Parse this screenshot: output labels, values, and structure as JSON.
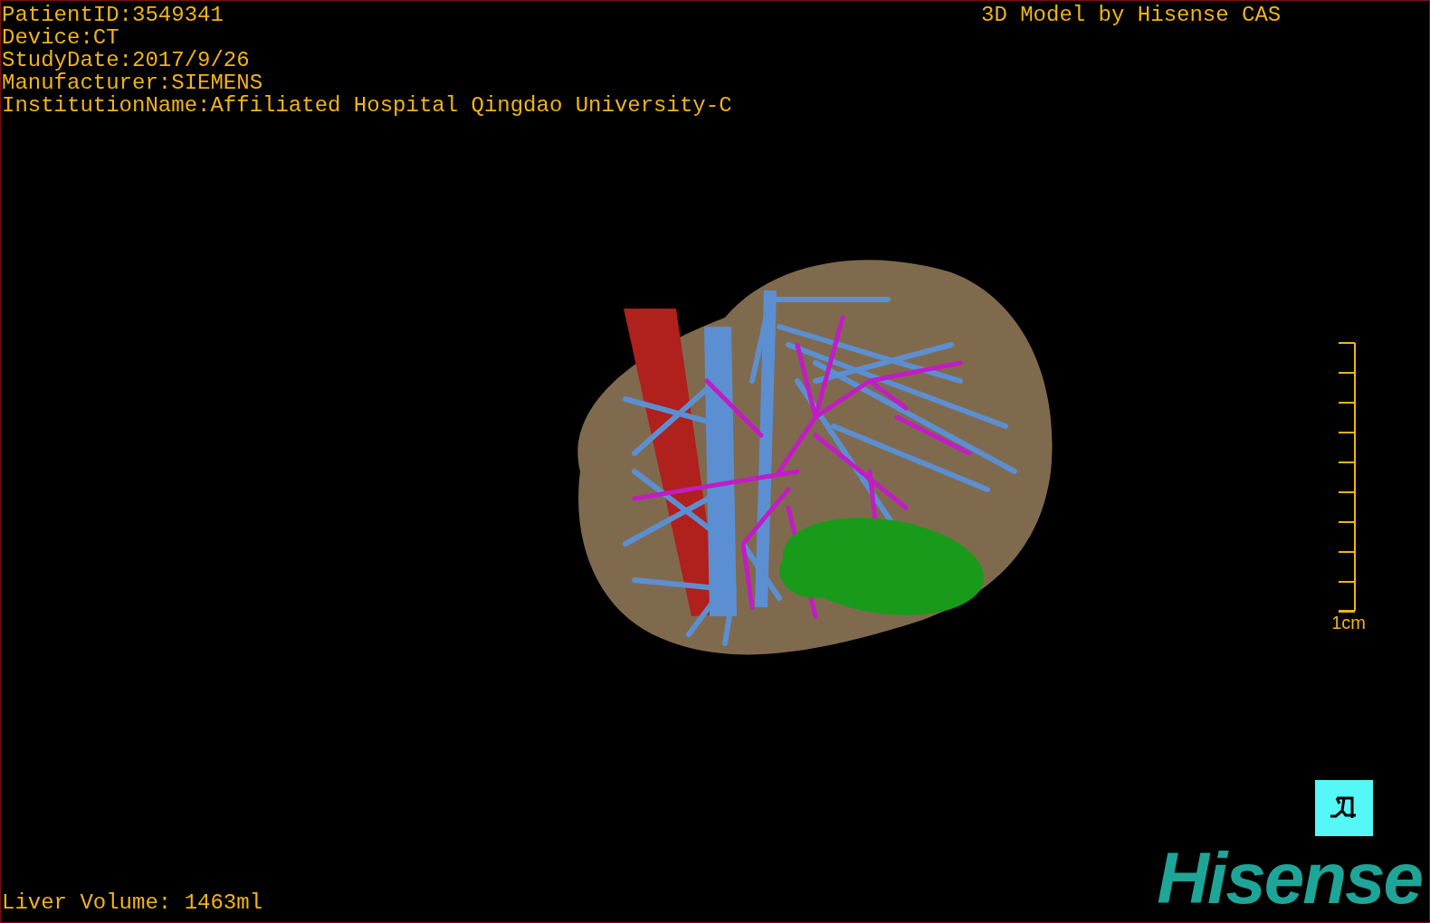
{
  "study_info": [
    "PatientID:3549341",
    "Device:CT",
    "StudyDate:2017/9/26",
    "Manufacturer:SIEMENS",
    "InstitutionName:Affiliated Hospital Qingdao University-C"
  ],
  "title": "3D Model by Hisense CAS",
  "scale_bar": {
    "label": "1cm"
  },
  "liver_volume": "Liver Volume: 1463ml",
  "logo": "Hisense"
}
